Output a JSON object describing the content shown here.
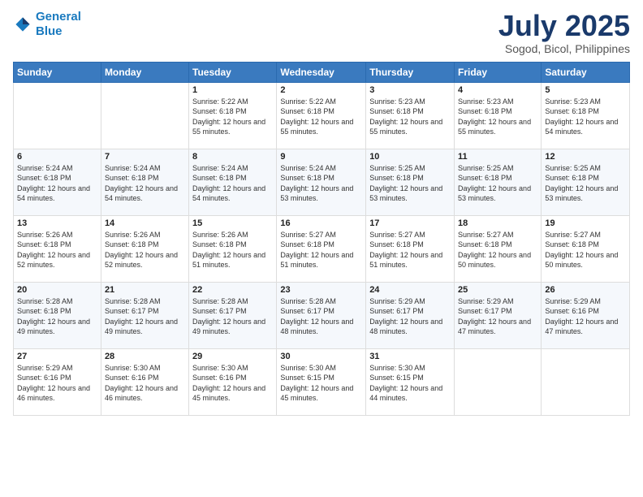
{
  "logo": {
    "line1": "General",
    "line2": "Blue"
  },
  "header": {
    "month": "July 2025",
    "location": "Sogod, Bicol, Philippines"
  },
  "days_of_week": [
    "Sunday",
    "Monday",
    "Tuesday",
    "Wednesday",
    "Thursday",
    "Friday",
    "Saturday"
  ],
  "weeks": [
    [
      {
        "day": "",
        "sunrise": "",
        "sunset": "",
        "daylight": ""
      },
      {
        "day": "",
        "sunrise": "",
        "sunset": "",
        "daylight": ""
      },
      {
        "day": "1",
        "sunrise": "Sunrise: 5:22 AM",
        "sunset": "Sunset: 6:18 PM",
        "daylight": "Daylight: 12 hours and 55 minutes."
      },
      {
        "day": "2",
        "sunrise": "Sunrise: 5:22 AM",
        "sunset": "Sunset: 6:18 PM",
        "daylight": "Daylight: 12 hours and 55 minutes."
      },
      {
        "day": "3",
        "sunrise": "Sunrise: 5:23 AM",
        "sunset": "Sunset: 6:18 PM",
        "daylight": "Daylight: 12 hours and 55 minutes."
      },
      {
        "day": "4",
        "sunrise": "Sunrise: 5:23 AM",
        "sunset": "Sunset: 6:18 PM",
        "daylight": "Daylight: 12 hours and 55 minutes."
      },
      {
        "day": "5",
        "sunrise": "Sunrise: 5:23 AM",
        "sunset": "Sunset: 6:18 PM",
        "daylight": "Daylight: 12 hours and 54 minutes."
      }
    ],
    [
      {
        "day": "6",
        "sunrise": "Sunrise: 5:24 AM",
        "sunset": "Sunset: 6:18 PM",
        "daylight": "Daylight: 12 hours and 54 minutes."
      },
      {
        "day": "7",
        "sunrise": "Sunrise: 5:24 AM",
        "sunset": "Sunset: 6:18 PM",
        "daylight": "Daylight: 12 hours and 54 minutes."
      },
      {
        "day": "8",
        "sunrise": "Sunrise: 5:24 AM",
        "sunset": "Sunset: 6:18 PM",
        "daylight": "Daylight: 12 hours and 54 minutes."
      },
      {
        "day": "9",
        "sunrise": "Sunrise: 5:24 AM",
        "sunset": "Sunset: 6:18 PM",
        "daylight": "Daylight: 12 hours and 53 minutes."
      },
      {
        "day": "10",
        "sunrise": "Sunrise: 5:25 AM",
        "sunset": "Sunset: 6:18 PM",
        "daylight": "Daylight: 12 hours and 53 minutes."
      },
      {
        "day": "11",
        "sunrise": "Sunrise: 5:25 AM",
        "sunset": "Sunset: 6:18 PM",
        "daylight": "Daylight: 12 hours and 53 minutes."
      },
      {
        "day": "12",
        "sunrise": "Sunrise: 5:25 AM",
        "sunset": "Sunset: 6:18 PM",
        "daylight": "Daylight: 12 hours and 53 minutes."
      }
    ],
    [
      {
        "day": "13",
        "sunrise": "Sunrise: 5:26 AM",
        "sunset": "Sunset: 6:18 PM",
        "daylight": "Daylight: 12 hours and 52 minutes."
      },
      {
        "day": "14",
        "sunrise": "Sunrise: 5:26 AM",
        "sunset": "Sunset: 6:18 PM",
        "daylight": "Daylight: 12 hours and 52 minutes."
      },
      {
        "day": "15",
        "sunrise": "Sunrise: 5:26 AM",
        "sunset": "Sunset: 6:18 PM",
        "daylight": "Daylight: 12 hours and 51 minutes."
      },
      {
        "day": "16",
        "sunrise": "Sunrise: 5:27 AM",
        "sunset": "Sunset: 6:18 PM",
        "daylight": "Daylight: 12 hours and 51 minutes."
      },
      {
        "day": "17",
        "sunrise": "Sunrise: 5:27 AM",
        "sunset": "Sunset: 6:18 PM",
        "daylight": "Daylight: 12 hours and 51 minutes."
      },
      {
        "day": "18",
        "sunrise": "Sunrise: 5:27 AM",
        "sunset": "Sunset: 6:18 PM",
        "daylight": "Daylight: 12 hours and 50 minutes."
      },
      {
        "day": "19",
        "sunrise": "Sunrise: 5:27 AM",
        "sunset": "Sunset: 6:18 PM",
        "daylight": "Daylight: 12 hours and 50 minutes."
      }
    ],
    [
      {
        "day": "20",
        "sunrise": "Sunrise: 5:28 AM",
        "sunset": "Sunset: 6:18 PM",
        "daylight": "Daylight: 12 hours and 49 minutes."
      },
      {
        "day": "21",
        "sunrise": "Sunrise: 5:28 AM",
        "sunset": "Sunset: 6:17 PM",
        "daylight": "Daylight: 12 hours and 49 minutes."
      },
      {
        "day": "22",
        "sunrise": "Sunrise: 5:28 AM",
        "sunset": "Sunset: 6:17 PM",
        "daylight": "Daylight: 12 hours and 49 minutes."
      },
      {
        "day": "23",
        "sunrise": "Sunrise: 5:28 AM",
        "sunset": "Sunset: 6:17 PM",
        "daylight": "Daylight: 12 hours and 48 minutes."
      },
      {
        "day": "24",
        "sunrise": "Sunrise: 5:29 AM",
        "sunset": "Sunset: 6:17 PM",
        "daylight": "Daylight: 12 hours and 48 minutes."
      },
      {
        "day": "25",
        "sunrise": "Sunrise: 5:29 AM",
        "sunset": "Sunset: 6:17 PM",
        "daylight": "Daylight: 12 hours and 47 minutes."
      },
      {
        "day": "26",
        "sunrise": "Sunrise: 5:29 AM",
        "sunset": "Sunset: 6:16 PM",
        "daylight": "Daylight: 12 hours and 47 minutes."
      }
    ],
    [
      {
        "day": "27",
        "sunrise": "Sunrise: 5:29 AM",
        "sunset": "Sunset: 6:16 PM",
        "daylight": "Daylight: 12 hours and 46 minutes."
      },
      {
        "day": "28",
        "sunrise": "Sunrise: 5:30 AM",
        "sunset": "Sunset: 6:16 PM",
        "daylight": "Daylight: 12 hours and 46 minutes."
      },
      {
        "day": "29",
        "sunrise": "Sunrise: 5:30 AM",
        "sunset": "Sunset: 6:16 PM",
        "daylight": "Daylight: 12 hours and 45 minutes."
      },
      {
        "day": "30",
        "sunrise": "Sunrise: 5:30 AM",
        "sunset": "Sunset: 6:15 PM",
        "daylight": "Daylight: 12 hours and 45 minutes."
      },
      {
        "day": "31",
        "sunrise": "Sunrise: 5:30 AM",
        "sunset": "Sunset: 6:15 PM",
        "daylight": "Daylight: 12 hours and 44 minutes."
      },
      {
        "day": "",
        "sunrise": "",
        "sunset": "",
        "daylight": ""
      },
      {
        "day": "",
        "sunrise": "",
        "sunset": "",
        "daylight": ""
      }
    ]
  ]
}
